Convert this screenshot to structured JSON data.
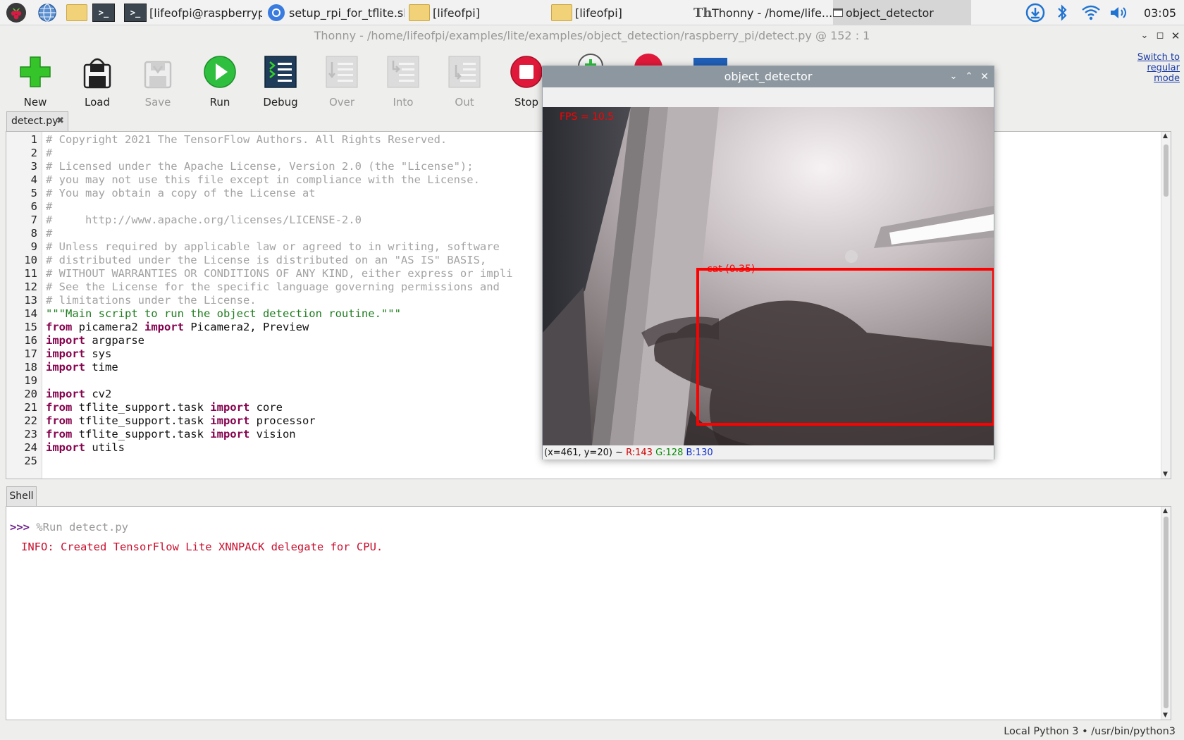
{
  "taskbar": {
    "items": [
      {
        "label": "[lifeofpi@raspberrypi:..."
      },
      {
        "label": "setup_rpi_for_tflite.sh..."
      },
      {
        "label": "[lifeofpi]"
      },
      {
        "label": "[lifeofpi]"
      },
      {
        "label": "Thonny  -  /home/life..."
      },
      {
        "label": "object_detector"
      }
    ],
    "clock": "03:05"
  },
  "window": {
    "title": "Thonny  -  /home/lifeofpi/examples/lite/examples/object_detection/raspberry_pi/detect.py  @  152 : 1"
  },
  "toolbar": {
    "buttons": [
      "New",
      "Load",
      "Save",
      "Run",
      "Debug",
      "Over",
      "Into",
      "Out",
      "Stop"
    ],
    "switch_mode": "Switch to regular mode"
  },
  "editor": {
    "tab": "detect.py",
    "lines": [
      [
        {
          "t": "# Copyright 2021 The TensorFlow Authors. All Rights Reserved.",
          "c": "cm"
        }
      ],
      [
        {
          "t": "#",
          "c": "cm"
        }
      ],
      [
        {
          "t": "# Licensed under the Apache License, Version 2.0 (the \"License\");",
          "c": "cm"
        }
      ],
      [
        {
          "t": "# you may not use this file except in compliance with the License.",
          "c": "cm"
        }
      ],
      [
        {
          "t": "# You may obtain a copy of the License at",
          "c": "cm"
        }
      ],
      [
        {
          "t": "#",
          "c": "cm"
        }
      ],
      [
        {
          "t": "#     http://www.apache.org/licenses/LICENSE-2.0",
          "c": "cm"
        }
      ],
      [
        {
          "t": "#",
          "c": "cm"
        }
      ],
      [
        {
          "t": "# Unless required by applicable law or agreed to in writing, software",
          "c": "cm"
        }
      ],
      [
        {
          "t": "# distributed under the License is distributed on an \"AS IS\" BASIS,",
          "c": "cm"
        }
      ],
      [
        {
          "t": "# WITHOUT WARRANTIES OR CONDITIONS OF ANY KIND, either express or impli",
          "c": "cm"
        }
      ],
      [
        {
          "t": "# See the License for the specific language governing permissions and",
          "c": "cm"
        }
      ],
      [
        {
          "t": "# limitations under the License.",
          "c": "cm"
        }
      ],
      [
        {
          "t": "\"\"\"Main script to run the object detection routine.\"\"\"",
          "c": "st"
        }
      ],
      [
        {
          "t": "from",
          "c": "kw"
        },
        {
          "t": " picamera2 ",
          "c": ""
        },
        {
          "t": "import",
          "c": "kw"
        },
        {
          "t": " Picamera2, Preview",
          "c": ""
        }
      ],
      [
        {
          "t": "import",
          "c": "kw"
        },
        {
          "t": " argparse",
          "c": ""
        }
      ],
      [
        {
          "t": "import",
          "c": "kw"
        },
        {
          "t": " sys",
          "c": ""
        }
      ],
      [
        {
          "t": "import",
          "c": "kw"
        },
        {
          "t": " time",
          "c": ""
        }
      ],
      [],
      [
        {
          "t": "import",
          "c": "kw"
        },
        {
          "t": " cv2",
          "c": ""
        }
      ],
      [
        {
          "t": "from",
          "c": "kw"
        },
        {
          "t": " tflite_support.task ",
          "c": ""
        },
        {
          "t": "import",
          "c": "kw"
        },
        {
          "t": " core",
          "c": ""
        }
      ],
      [
        {
          "t": "from",
          "c": "kw"
        },
        {
          "t": " tflite_support.task ",
          "c": ""
        },
        {
          "t": "import",
          "c": "kw"
        },
        {
          "t": " processor",
          "c": ""
        }
      ],
      [
        {
          "t": "from",
          "c": "kw"
        },
        {
          "t": " tflite_support.task ",
          "c": ""
        },
        {
          "t": "import",
          "c": "kw"
        },
        {
          "t": " vision",
          "c": ""
        }
      ],
      [
        {
          "t": "import",
          "c": "kw"
        },
        {
          "t": " utils",
          "c": ""
        }
      ],
      []
    ]
  },
  "shell": {
    "tab": "Shell",
    "prompt": ">>>",
    "command": "%Run detect.py",
    "output": "INFO: Created TensorFlow Lite XNNPACK delegate for CPU."
  },
  "status_bar": {
    "interpreter": "Local Python 3  •  /usr/bin/python3"
  },
  "object_detector": {
    "title": "object_detector",
    "fps_text": "FPS = 10.5",
    "detection_label": "cat (0.35)",
    "pixel_info": {
      "coords": "(x=461, y=20) ~",
      "r": "R:143",
      "g": "G:128",
      "b": "B:130"
    }
  },
  "colors": {
    "keyword": "#85034e",
    "string": "#1f7d1f",
    "comment": "#a3a3a3",
    "error_output": "#c8102e",
    "detection_box": "#ff0000"
  }
}
